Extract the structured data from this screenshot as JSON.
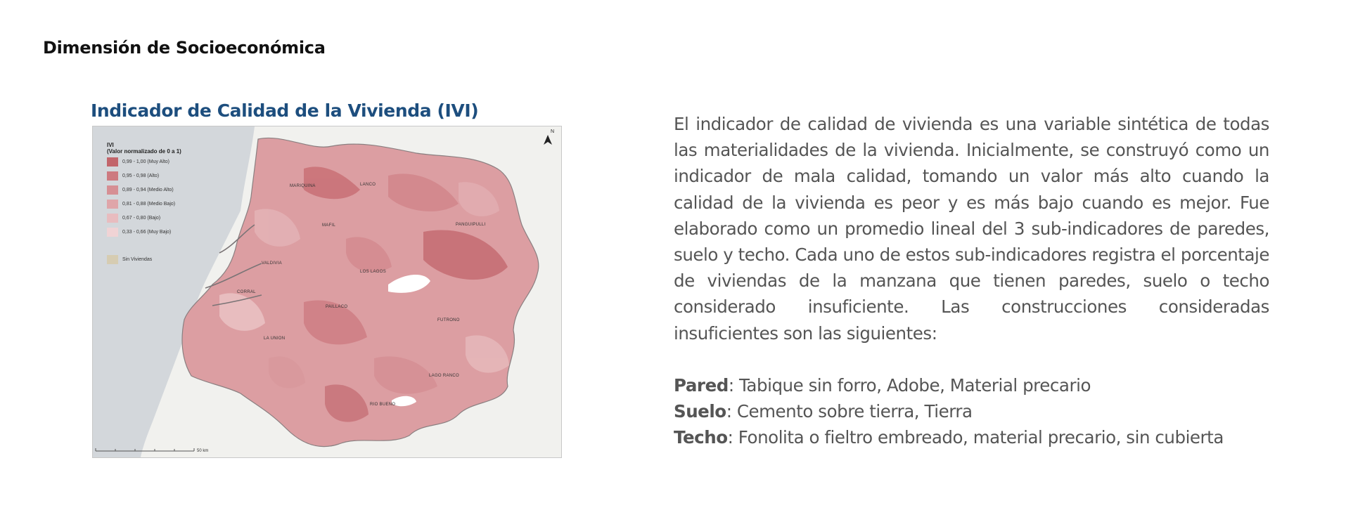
{
  "page_title": "Dimensión de Socioeconómica",
  "map": {
    "title": "Indicador de Calidad de la Vivienda (IVI)",
    "legend_title_line1": "IVI",
    "legend_title_line2": "(Valor normalizado de 0 a 1)",
    "legend_items": [
      {
        "label": "0,99 - 1,00 (Muy Alto)",
        "color": "#c2656b"
      },
      {
        "label": "0,95 - 0,98 (Alto)",
        "color": "#cd7a80"
      },
      {
        "label": "0,89 - 0,94 (Medio Alto)",
        "color": "#d68f94"
      },
      {
        "label": "0,81 - 0,88 (Medio Bajo)",
        "color": "#dfa5a9"
      },
      {
        "label": "0,67 - 0,80 (Bajo)",
        "color": "#e8bcbf"
      },
      {
        "label": "0,33 - 0,66 (Muy Bajo)",
        "color": "#f0d3d5"
      }
    ],
    "no_data_label": "Sin Viviendas",
    "no_data_color": "#d6ccb2",
    "places": [
      "MARIQUINA",
      "LANCO",
      "MAFIL",
      "PANGUIPULLI",
      "VALDIVIA",
      "LOS LAGOS",
      "CORRAL",
      "PAILLACO",
      "FUTRONO",
      "LA UNION",
      "LAGO RANCO",
      "RIO BUENO"
    ],
    "north_label": "N",
    "scale_label": "50 km"
  },
  "description": "El indicador de calidad de vivienda es una variable sintética de todas las materialidades de la vivienda. Inicialmente, se construyó como un indicador de mala calidad, tomando un valor más alto cuando la calidad de la vivienda es peor y es más bajo cuando es mejor. Fue elaborado como un promedio lineal del 3 sub-indicadores de paredes, suelo y techo. Cada uno de estos sub-indicadores registra el porcentaje de viviendas de la manzana que tienen paredes, suelo o techo considerado insuficiente. Las construcciones consideradas insuficientes son las siguientes:",
  "definitions": [
    {
      "term": "Pared",
      "text": ": Tabique sin forro, Adobe, Material precario"
    },
    {
      "term": "Suelo",
      "text": ": Cemento sobre tierra, Tierra"
    },
    {
      "term": "Techo",
      "text": ": Fonolita o fieltro embreado, material precario, sin cubierta"
    }
  ]
}
